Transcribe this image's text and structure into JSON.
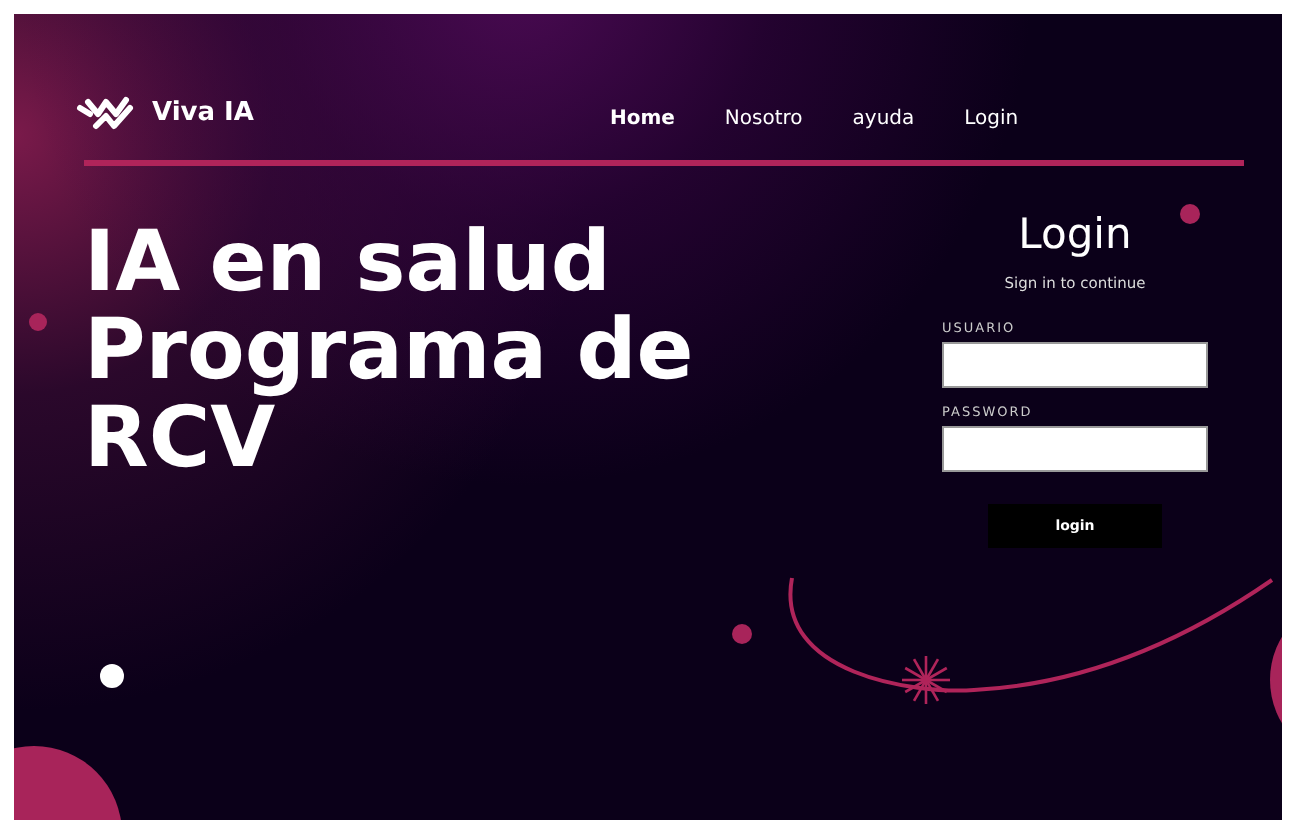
{
  "brand": {
    "name": "Viva IA"
  },
  "nav": [
    {
      "label": "Home",
      "selected": true
    },
    {
      "label": "Nosotro",
      "selected": false
    },
    {
      "label": "ayuda",
      "selected": false
    },
    {
      "label": "Login",
      "selected": false
    }
  ],
  "hero": {
    "lines": [
      "IA en salud",
      "Programa de",
      "RCV"
    ]
  },
  "login": {
    "title": "Login",
    "subtitle": "Sign in to continue",
    "fields": [
      {
        "label": "USUARIO"
      },
      {
        "label": "PASSWORD"
      }
    ],
    "button": "login"
  }
}
